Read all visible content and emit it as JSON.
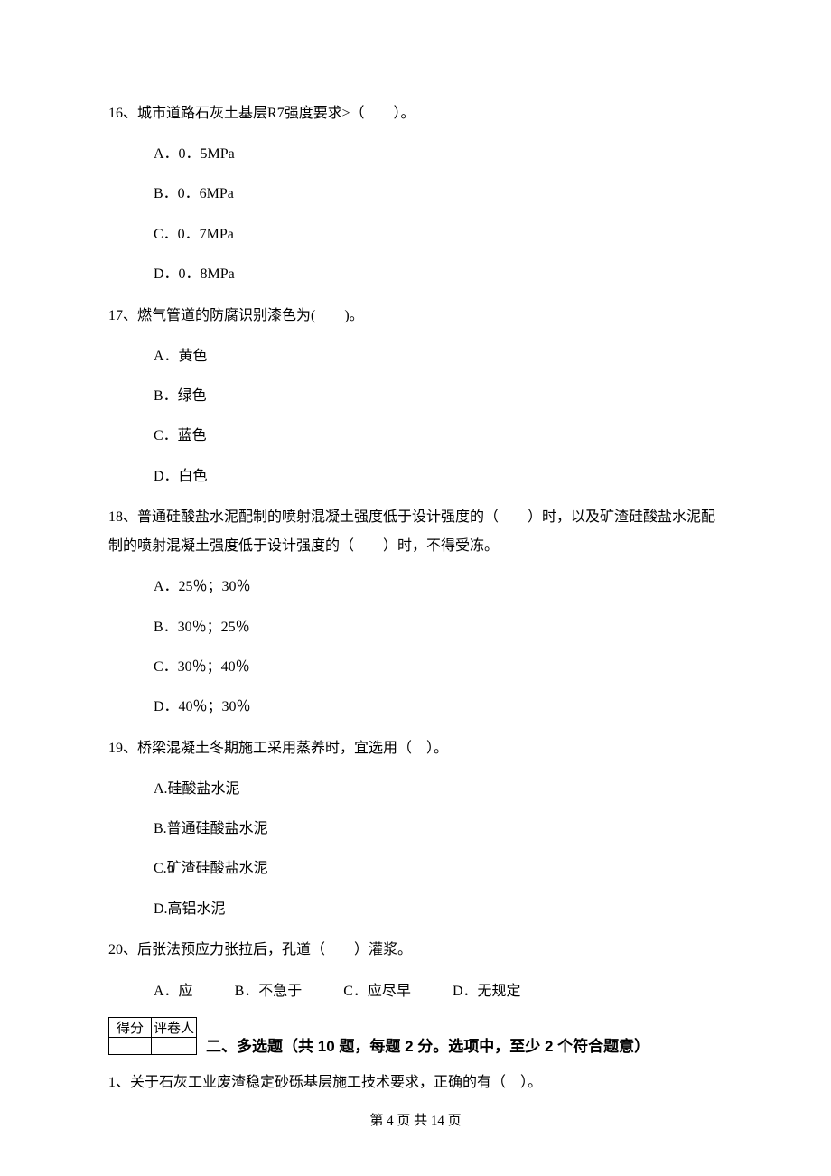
{
  "questions": [
    {
      "num": "16、",
      "text": "城市道路石灰土基层R7强度要求≥（　　）。",
      "options": [
        "A．0．5MPa",
        "B．0．6MPa",
        "C．0．7MPa",
        "D．0．8MPa"
      ]
    },
    {
      "num": "17、",
      "text": "燃气管道的防腐识别漆色为(　　)。",
      "options": [
        "A．黄色",
        "B．绿色",
        "C．蓝色",
        "D．白色"
      ]
    },
    {
      "num": "18、",
      "text": "普通硅酸盐水泥配制的喷射混凝土强度低于设计强度的（　　）时，以及矿渣硅酸盐水泥配制的喷射混凝土强度低于设计强度的（　　）时，不得受冻。",
      "options": [
        "A．25％；30％",
        "B．30％；25％",
        "C．30％；40％",
        "D．40％；30％"
      ]
    },
    {
      "num": "19、",
      "text": "桥梁混凝土冬期施工采用蒸养时，宜选用（　）。",
      "options": [
        "A.硅酸盐水泥",
        "B.普通硅酸盐水泥",
        "C.矿渣硅酸盐水泥",
        "D.高铝水泥"
      ]
    },
    {
      "num": "20、",
      "text": "后张法预应力张拉后，孔道（　　）灌浆。",
      "inline_options": [
        "A．应",
        "B．不急于",
        "C．应尽早",
        "D．无规定"
      ]
    }
  ],
  "score_table": {
    "h1": "得分",
    "h2": "评卷人"
  },
  "section2": {
    "title": "二、多选题（共 10 题，每题 2 分。选项中，至少 2 个符合题意）"
  },
  "sec2_q1": {
    "num": "1、",
    "text": "关于石灰工业废渣稳定砂砾基层施工技术要求，正确的有（　）。"
  },
  "footer": "第 4 页 共 14 页"
}
